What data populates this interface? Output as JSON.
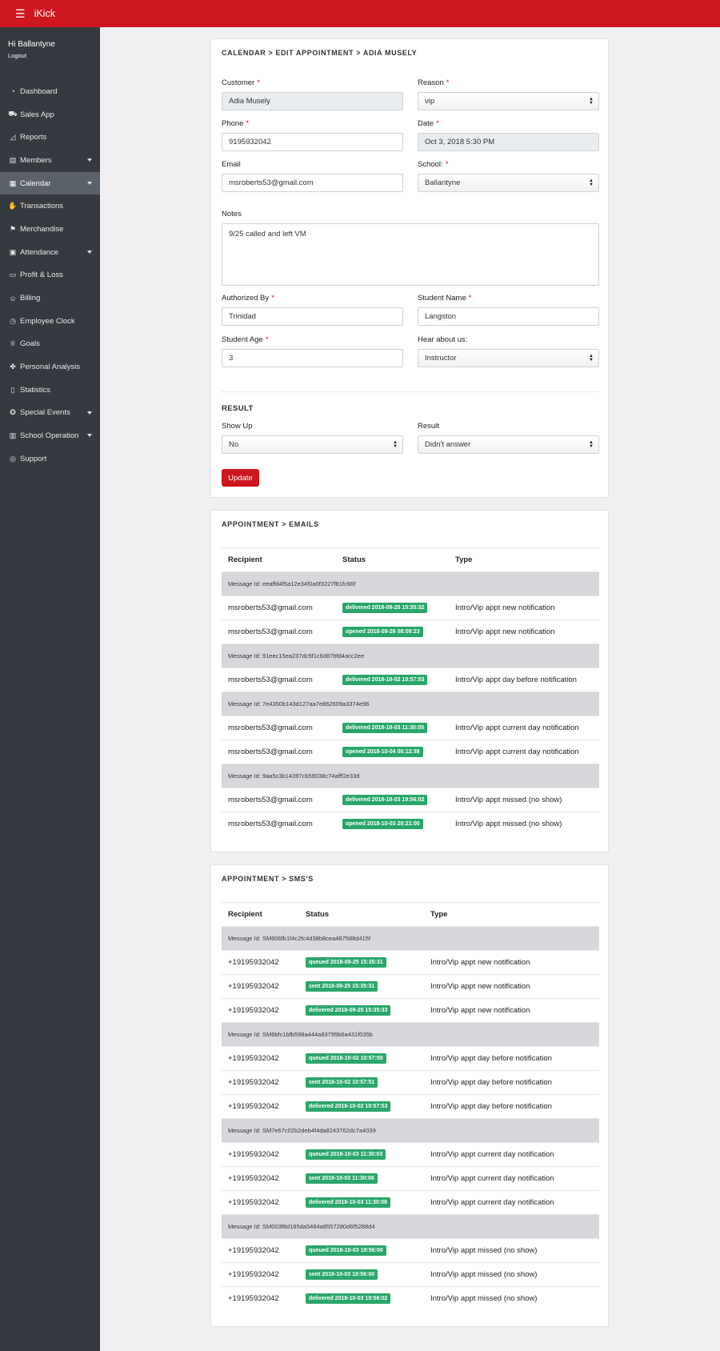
{
  "app": {
    "brand": "iKick",
    "greeting": "Hi Ballantyne",
    "logout": "Logout"
  },
  "nav": [
    {
      "icon": "dashboard-icon",
      "glyph": "◔",
      "label": "Dashboard",
      "caret": false,
      "active": false
    },
    {
      "icon": "cart-icon",
      "glyph": "⛟",
      "label": "Sales App",
      "caret": false,
      "active": false
    },
    {
      "icon": "chart-icon",
      "glyph": "◿",
      "label": "Reports",
      "caret": false,
      "active": false
    },
    {
      "icon": "id-card-icon",
      "glyph": "▤",
      "label": "Members",
      "caret": true,
      "active": false
    },
    {
      "icon": "calendar-icon",
      "glyph": "▦",
      "label": "Calendar",
      "caret": true,
      "active": true
    },
    {
      "icon": "hand-money-icon",
      "glyph": "✋",
      "label": "Transactions",
      "caret": false,
      "active": false
    },
    {
      "icon": "tags-icon",
      "glyph": "⚑",
      "label": "Merchandise",
      "caret": false,
      "active": false
    },
    {
      "icon": "clipboard-icon",
      "glyph": "▣",
      "label": "Attendance",
      "caret": true,
      "active": false
    },
    {
      "icon": "money-bill-icon",
      "glyph": "▭",
      "label": "Profit & Loss",
      "caret": false,
      "active": false
    },
    {
      "icon": "user-icon",
      "glyph": "☺",
      "label": "Billing",
      "caret": false,
      "active": false
    },
    {
      "icon": "clock-icon",
      "glyph": "◷",
      "label": "Employee Clock",
      "caret": false,
      "active": false
    },
    {
      "icon": "trophy-icon",
      "glyph": "♕",
      "label": "Goals",
      "caret": false,
      "active": false
    },
    {
      "icon": "handshake-icon",
      "glyph": "✤",
      "label": "Personal Analysis",
      "caret": false,
      "active": false
    },
    {
      "icon": "file-icon",
      "glyph": "▯",
      "label": "Statistics",
      "caret": false,
      "active": false
    },
    {
      "icon": "award-icon",
      "glyph": "✪",
      "label": "Special Events",
      "caret": true,
      "active": false
    },
    {
      "icon": "building-icon",
      "glyph": "▥",
      "label": "School Operation",
      "caret": true,
      "active": false
    },
    {
      "icon": "life-ring-icon",
      "glyph": "◎",
      "label": "Support",
      "caret": false,
      "active": false
    }
  ],
  "form": {
    "breadcrumb": "CALENDAR > EDIT APPOINTMENT > ADIA MUSELY",
    "required_mark": "*",
    "customer_label": "Customer",
    "customer_value": "Adia Musely",
    "reason_label": "Reason",
    "reason_value": "vip",
    "phone_label": "Phone",
    "phone_value": "9195932042",
    "date_label": "Date",
    "date_value": "Oct 3, 2018 5:30 PM",
    "email_label": "Email",
    "email_value": "msroberts53@gmail.com",
    "school_label": "School:",
    "school_value": "Ballantyne",
    "notes_label": "Notes",
    "notes_value": "9/25 called and left VM",
    "authorized_label": "Authorized By",
    "authorized_value": "Trinidad",
    "student_name_label": "Student Name",
    "student_name_value": "Langston",
    "student_age_label": "Student Age",
    "student_age_value": "3",
    "hear_label": "Hear about us:",
    "hear_value": "Instructor",
    "result_title": "RESULT",
    "show_up_label": "Show Up",
    "show_up_value": "No",
    "result_label": "Result",
    "result_value": "Didn't answer",
    "update_label": "Update"
  },
  "emails": {
    "title": "APPOINTMENT > EMAILS",
    "headers": {
      "recipient": "Recipient",
      "status": "Status",
      "type": "Type"
    },
    "groups": [
      {
        "message_id": "Message Id: eeaffd4f5a12e34f0a0f3227f81fc66f",
        "rows": [
          {
            "recipient": "msroberts53@gmail.com",
            "status": "delivered 2018-09-25 15:35:32",
            "type": "Intro/Vip appt new notification"
          },
          {
            "recipient": "msroberts53@gmail.com",
            "status": "opened 2018-09-26 08:09:23",
            "type": "Intro/Vip appt new notification"
          }
        ]
      },
      {
        "message_id": "Message Id: 91eec15ea237dc5f1c6d87bfd4acc2ee",
        "rows": [
          {
            "recipient": "msroberts53@gmail.com",
            "status": "delivered 2018-10-02 10:57:53",
            "type": "Intro/Vip appt day before notification"
          }
        ]
      },
      {
        "message_id": "Message Id: 7e4350b143d127aa7e862609a3374e96",
        "rows": [
          {
            "recipient": "msroberts53@gmail.com",
            "status": "delivered 2018-10-03 11:30:05",
            "type": "Intro/Vip appt current day notification"
          },
          {
            "recipient": "msroberts53@gmail.com",
            "status": "opened 2018-10-04 00:12:38",
            "type": "Intro/Vip appt current day notification"
          }
        ]
      },
      {
        "message_id": "Message Id: 9aa5c3b14397cb59038c74afff2e33d",
        "rows": [
          {
            "recipient": "msroberts53@gmail.com",
            "status": "delivered 2018-10-03 19:56:02",
            "type": "Intro/Vip appt missed (no show)"
          },
          {
            "recipient": "msroberts53@gmail.com",
            "status": "opened 2018-10-03 20:21:00",
            "type": "Intro/Vip appt missed (no show)"
          }
        ]
      }
    ]
  },
  "sms": {
    "title": "APPOINTMENT > SMS'S",
    "headers": {
      "recipient": "Recipient",
      "status": "Status",
      "type": "Type"
    },
    "groups": [
      {
        "message_id": "Message Id: SM606fb1f4c2fc4d38b8cea487588d415f",
        "rows": [
          {
            "recipient": "+19195932042",
            "status": "queued 2018-09-25 15:35:31",
            "type": "Intro/Vip appt new notification"
          },
          {
            "recipient": "+19195932042",
            "status": "sent 2018-09-25 15:35:31",
            "type": "Intro/Vip appt new notification"
          },
          {
            "recipient": "+19195932042",
            "status": "delivered 2018-09-25 15:35:33",
            "type": "Intro/Vip appt new notification"
          }
        ]
      },
      {
        "message_id": "Message Id: SM6bfc1bfb598a444a83795b6a431f035b",
        "rows": [
          {
            "recipient": "+19195932042",
            "status": "queued 2018-10-02 10:57:50",
            "type": "Intro/Vip appt day before notification"
          },
          {
            "recipient": "+19195932042",
            "status": "sent 2018-10-02 10:57:51",
            "type": "Intro/Vip appt day before notification"
          },
          {
            "recipient": "+19195932042",
            "status": "delivered 2018-10-02 10:57:53",
            "type": "Intro/Vip appt day before notification"
          }
        ]
      },
      {
        "message_id": "Message Id: SM7e67c02b2deb4f4da8243762dc7a4039",
        "rows": [
          {
            "recipient": "+19195932042",
            "status": "queued 2018-10-03 11:30:03",
            "type": "Intro/Vip appt current day notification"
          },
          {
            "recipient": "+19195932042",
            "status": "sent 2018-10-03 11:30:06",
            "type": "Intro/Vip appt current day notification"
          },
          {
            "recipient": "+19195932042",
            "status": "delivered 2018-10-03 11:30:08",
            "type": "Intro/Vip appt current day notification"
          }
        ]
      },
      {
        "message_id": "Message Id: SM003f8d185da5484a8557280d6f5288d4",
        "rows": [
          {
            "recipient": "+19195932042",
            "status": "queued 2018-10-03 19:56:00",
            "type": "Intro/Vip appt missed (no show)"
          },
          {
            "recipient": "+19195932042",
            "status": "sent 2018-10-03 19:56:00",
            "type": "Intro/Vip appt missed (no show)"
          },
          {
            "recipient": "+19195932042",
            "status": "delivered 2018-10-03 19:56:02",
            "type": "Intro/Vip appt missed (no show)"
          }
        ]
      }
    ]
  },
  "colors": {
    "brand_red": "#cd161d",
    "sidebar": "#343a40",
    "badge_green": "#2aa66a"
  }
}
